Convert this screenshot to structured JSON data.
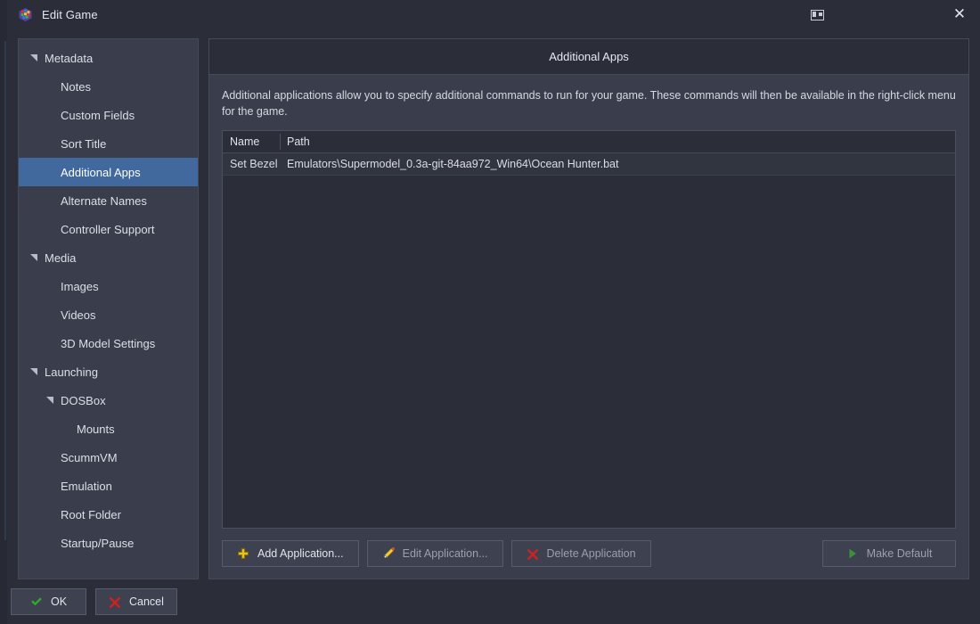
{
  "window": {
    "title": "Edit Game",
    "app_icon": "launchbox-cube-icon",
    "layout_button_icon": "window-layout-icon",
    "close_button_icon": "close-icon"
  },
  "sidebar": {
    "items": [
      {
        "label": "Metadata",
        "level": 0,
        "expander": true,
        "selected": false
      },
      {
        "label": "Notes",
        "level": 1,
        "expander": false,
        "selected": false
      },
      {
        "label": "Custom Fields",
        "level": 1,
        "expander": false,
        "selected": false
      },
      {
        "label": "Sort Title",
        "level": 1,
        "expander": false,
        "selected": false
      },
      {
        "label": "Additional Apps",
        "level": 1,
        "expander": false,
        "selected": true
      },
      {
        "label": "Alternate Names",
        "level": 1,
        "expander": false,
        "selected": false
      },
      {
        "label": "Controller Support",
        "level": 1,
        "expander": false,
        "selected": false
      },
      {
        "label": "Media",
        "level": 0,
        "expander": true,
        "selected": false
      },
      {
        "label": "Images",
        "level": 1,
        "expander": false,
        "selected": false
      },
      {
        "label": "Videos",
        "level": 1,
        "expander": false,
        "selected": false
      },
      {
        "label": "3D Model Settings",
        "level": 1,
        "expander": false,
        "selected": false
      },
      {
        "label": "Launching",
        "level": 0,
        "expander": true,
        "selected": false
      },
      {
        "label": "DOSBox",
        "level": 1,
        "expander": true,
        "selected": false
      },
      {
        "label": "Mounts",
        "level": 2,
        "expander": false,
        "selected": false
      },
      {
        "label": "ScummVM",
        "level": 1,
        "expander": false,
        "selected": false
      },
      {
        "label": "Emulation",
        "level": 1,
        "expander": false,
        "selected": false
      },
      {
        "label": "Root Folder",
        "level": 1,
        "expander": false,
        "selected": false
      },
      {
        "label": "Startup/Pause",
        "level": 1,
        "expander": false,
        "selected": false
      }
    ]
  },
  "panel": {
    "title": "Additional Apps",
    "description": "Additional applications allow you to specify additional commands to run for your game.  These commands will then be available in the right-click menu for the game."
  },
  "grid": {
    "columns": [
      "Name",
      "Path"
    ],
    "rows": [
      {
        "name": "Set Bezel",
        "path": "Emulators\\Supermodel_0.3a-git-84aa972_Win64\\Ocean Hunter.bat"
      }
    ]
  },
  "actions": {
    "add": {
      "label": "Add Application...",
      "icon": "plus-icon",
      "enabled": true
    },
    "edit": {
      "label": "Edit Application...",
      "icon": "pencil-icon",
      "enabled": false
    },
    "delete": {
      "label": "Delete Application",
      "icon": "red-x-icon",
      "enabled": false
    },
    "make_default": {
      "label": "Make Default",
      "icon": "green-play-icon",
      "enabled": false
    }
  },
  "footer": {
    "ok": {
      "label": "OK",
      "icon": "green-check-icon"
    },
    "cancel": {
      "label": "Cancel",
      "icon": "red-x-icon"
    }
  },
  "colors": {
    "accent_selected": "#41699e",
    "panel_bg": "#3a3e4c",
    "window_bg": "#2b2e39",
    "grid_bg": "#2b2e39",
    "plus_yellow": "#e8c41e",
    "red_x": "#cc2222",
    "green_check": "#2fa82f",
    "green_play": "#3c8f3c"
  }
}
